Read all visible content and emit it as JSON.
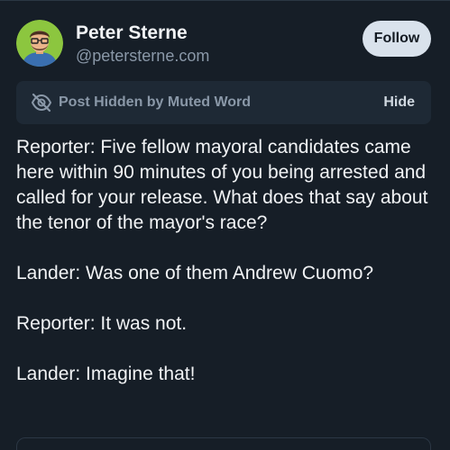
{
  "author": {
    "display_name": "Peter Sterne",
    "handle": "@petersterne.com",
    "avatar_icon": "cartoon-portrait-avatar"
  },
  "follow_button": {
    "label": "Follow"
  },
  "muted_notice": {
    "icon": "eye-slash-icon",
    "label": "Post Hidden by Muted Word",
    "hide_label": "Hide"
  },
  "post": {
    "paragraphs": [
      "Reporter: Five fellow mayoral candidates came here within 90 minutes of you being arrested and called for your release. What does that say about the tenor of the mayor's race?",
      "Lander: Was one of them Andrew Cuomo?",
      "Reporter: It was not.",
      "Lander: Imagine that!"
    ]
  },
  "colors": {
    "background": "#161e27",
    "banner_background": "#1e2935",
    "follow_button_background": "#d9e2ec",
    "muted_text": "#8a98a8",
    "primary_text": "#f1f3f5"
  }
}
